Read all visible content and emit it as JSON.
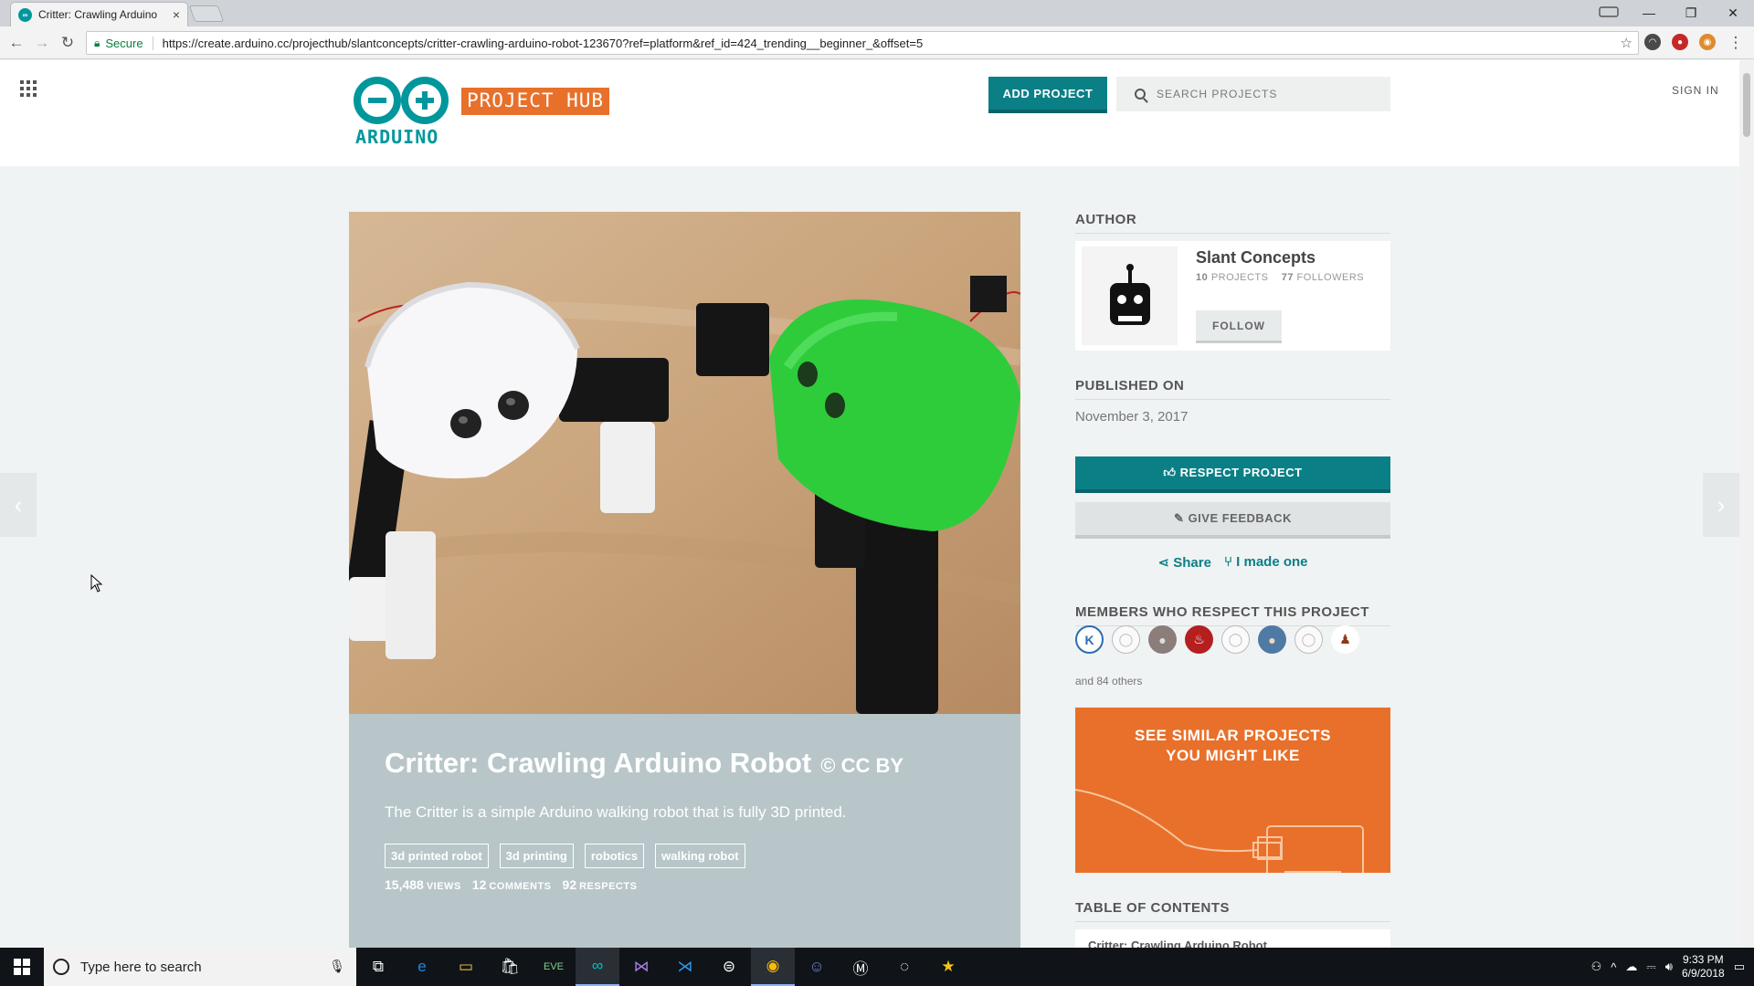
{
  "browser": {
    "tab_title": "Critter: Crawling Arduino",
    "tab_close": "×",
    "secure_label": "Secure",
    "url": "https://create.arduino.cc/projecthub/slantconcepts/critter-crawling-arduino-robot-123670?ref=platform&ref_id=424_trending__beginner_&offset=5"
  },
  "header": {
    "logo_wordmark": "ARDUINO",
    "logo_hub": "PROJECT HUB",
    "add_project": "ADD PROJECT",
    "search_placeholder": "SEARCH PROJECTS",
    "sign_in": "SIGN IN"
  },
  "project": {
    "title": "Critter: Crawling Arduino Robot",
    "license": "© CC BY",
    "description": "The Critter is a simple Arduino walking robot that is fully 3D printed.",
    "tags": [
      "3d printed robot",
      "3d printing",
      "robotics",
      "walking robot"
    ],
    "views": "15,488",
    "views_label": "VIEWS",
    "comments": "12",
    "comments_label": "COMMENTS",
    "respects": "92",
    "respects_label": "RESPECTS"
  },
  "sidebar": {
    "author_heading": "AUTHOR",
    "author_name": "Slant Concepts",
    "author_projects": "10",
    "author_projects_label": "PROJECTS",
    "author_followers": "77",
    "author_followers_label": "FOLLOWERS",
    "follow": "FOLLOW",
    "published_heading": "PUBLISHED ON",
    "published_date": "November 3, 2017",
    "respect_button": "RESPECT PROJECT",
    "feedback_button": "GIVE FEEDBACK",
    "share": "Share",
    "made_one": "I made one",
    "members_heading": "MEMBERS WHO RESPECT THIS PROJECT",
    "others": "and 84 others",
    "similar_line1": "SEE SIMILAR PROJECTS",
    "similar_line2": "YOU MIGHT LIKE",
    "toc_heading": "TABLE OF CONTENTS",
    "toc_first": "Critter: Crawling Arduino Robot"
  },
  "taskbar": {
    "search_placeholder": "Type here to search",
    "time": "9:33 PM",
    "date": "6/9/2018"
  },
  "colors": {
    "teal": "#00979c",
    "orange": "#e8702a",
    "green_robot": "#2ecc3b"
  }
}
